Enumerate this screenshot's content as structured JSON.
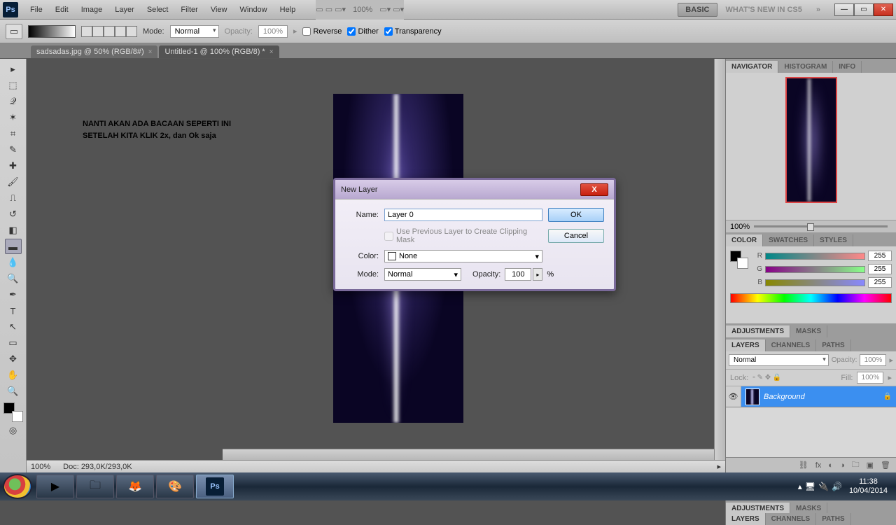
{
  "app": {
    "logo": "Ps"
  },
  "menu": [
    "File",
    "Edit",
    "Image",
    "Layer",
    "Select",
    "Filter",
    "View",
    "Window",
    "Help"
  ],
  "menu_buttons": {
    "basic": "BASIC",
    "whatsnew": "WHAT'S NEW IN CS5",
    "arrows": "»"
  },
  "optbar": {
    "mode_label": "Mode:",
    "mode_value": "Normal",
    "opacity_label": "Opacity:",
    "opacity_value": "100%",
    "reverse": "Reverse",
    "dither": "Dither",
    "transparency": "Transparency",
    "zoom": "100%"
  },
  "doc_tabs": [
    {
      "title": "sadsadas.jpg @ 50% (RGB/8#)"
    },
    {
      "title": "Untitled-1 @ 100% (RGB/8) *"
    }
  ],
  "annotation": {
    "line1": "NANTI AKAN ADA BACAAN SEPERTI INI",
    "line2": "SETELAH KITA KLIK 2x, dan Ok saja"
  },
  "dialog": {
    "title": "New Layer",
    "name_label": "Name:",
    "name_value": "Layer 0",
    "use_prev": "Use Previous Layer to Create Clipping Mask",
    "color_label": "Color:",
    "color_value": "None",
    "mode_label": "Mode:",
    "mode_value": "Normal",
    "opacity_label": "Opacity:",
    "opacity_value": "100",
    "pct": "%",
    "ok": "OK",
    "cancel": "Cancel"
  },
  "status": {
    "zoom": "100%",
    "doc": "Doc: 293,0K/293,0K"
  },
  "panels": {
    "nav_tabs": [
      "NAVIGATOR",
      "HISTOGRAM",
      "INFO"
    ],
    "nav_zoom": "100%",
    "color_tabs": [
      "COLOR",
      "SWATCHES",
      "STYLES"
    ],
    "rgb": [
      {
        "l": "R",
        "v": "255",
        "grad": "linear-gradient(to right,#088,#f88)"
      },
      {
        "l": "G",
        "v": "255",
        "grad": "linear-gradient(to right,#808,#8f8)"
      },
      {
        "l": "B",
        "v": "255",
        "grad": "linear-gradient(to right,#880,#88f)"
      }
    ],
    "adj_tabs": [
      "ADJUSTMENTS",
      "MASKS"
    ],
    "layer_tabs": [
      "LAYERS",
      "CHANNELS",
      "PATHS"
    ],
    "layer_blend": "Normal",
    "layer_op_lbl": "Opacity:",
    "layer_op": "100%",
    "lock_lbl": "Lock:",
    "fill_lbl": "Fill:",
    "fill_val": "100%",
    "layers": [
      {
        "name": "Background"
      }
    ],
    "adj_tabs2": [
      "ADJUSTMENTS",
      "MASKS"
    ],
    "layer_tabs2": [
      "LAYERS",
      "CHANNELS",
      "PATHS"
    ]
  },
  "tray": {
    "time": "11:38",
    "date": "10/04/2014"
  }
}
